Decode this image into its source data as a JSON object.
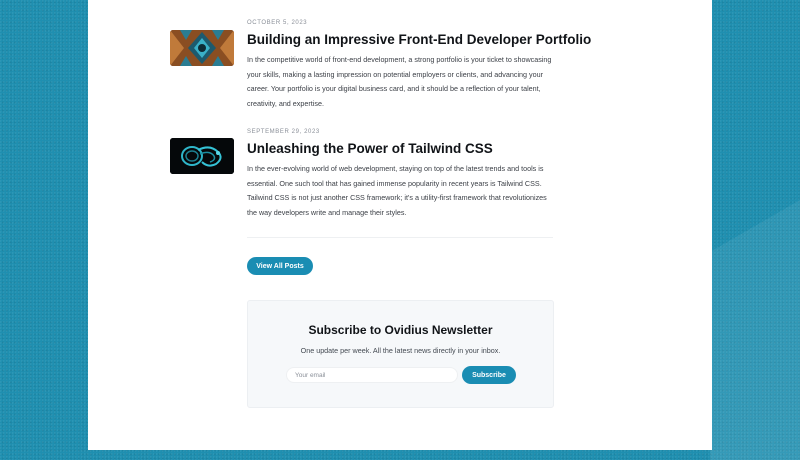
{
  "posts": [
    {
      "date": "OCTOBER 5, 2023",
      "title": "Building an Impressive Front-End Developer Portfolio",
      "excerpt": "In the competitive world of front-end development, a strong portfolio is your ticket to showcasing your skills, making a lasting impression on potential employers or clients, and advancing your career. Your portfolio is your digital business card, and it should be a reflection of your talent, creativity, and expertise.",
      "thumbnail": "kaleidoscope-image"
    },
    {
      "date": "SEPTEMBER 29, 2023",
      "title": "Unleashing the Power of Tailwind CSS",
      "excerpt": "In the ever-evolving world of web development, staying on top of the latest trends and tools is essential. One such tool that has gained immense popularity in recent years is Tailwind CSS. Tailwind CSS is not just another CSS framework; it's a utility-first framework that revolutionizes the way developers write and manage their styles.",
      "thumbnail": "abstract-3d-shape-image"
    }
  ],
  "view_all_label": "View All Posts",
  "newsletter": {
    "title": "Subscribe to Ovidius Newsletter",
    "subtitle": "One update per week. All the latest news directly in your inbox.",
    "email_placeholder": "Your email",
    "button_label": "Subscribe"
  },
  "colors": {
    "accent": "#1a8db3",
    "background": "#1f8fb0"
  }
}
